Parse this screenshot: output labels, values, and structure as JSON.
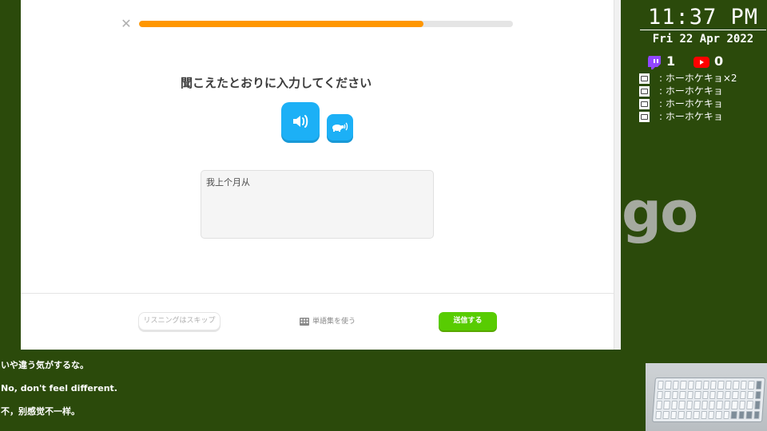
{
  "lesson": {
    "close_icon": "close-icon",
    "progress_percent": 76,
    "prompt": "聞こえたとおりに入力してください",
    "speaker_icon": "speaker-icon",
    "slow_icon": "turtle-icon",
    "answer_value": "我上个月从",
    "skip_label": "リスニングはスキップ",
    "wordbank_label": "単語集を使う",
    "submit_label": "送信する",
    "colors": {
      "progress": "#ff9600",
      "speaker": "#1cb0f6",
      "submit": "#58cc02"
    }
  },
  "overlay": {
    "time": "11:37 PM",
    "date": "Fri 22 Apr 2022",
    "twitch_count": "1",
    "youtube_count": "0",
    "chat": [
      {
        "text": ": ホーホケキョ×2"
      },
      {
        "text": ": ホーホケキョ"
      },
      {
        "text": ": ホーホケキョ"
      },
      {
        "text": ": ホーホケキョ"
      }
    ],
    "watermark": "go"
  },
  "subtitles": {
    "japanese": "いや違う気がするな。",
    "english": "No, don't feel different.",
    "chinese": "不，别感觉不一样。"
  }
}
